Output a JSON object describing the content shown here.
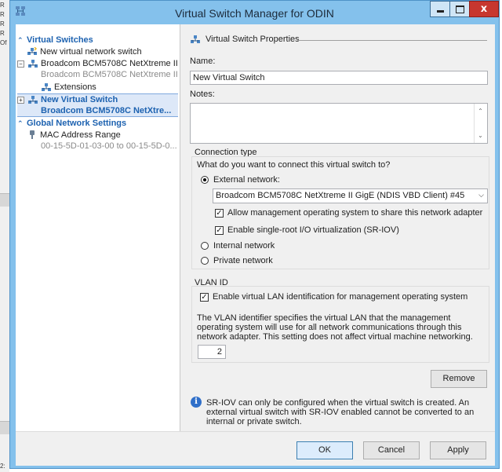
{
  "background_app": {
    "fragments": [
      "R",
      "R",
      "R",
      "R",
      "Of"
    ],
    "bottom_fragment": "2:"
  },
  "window": {
    "title": "Virtual Switch Manager for ODIN",
    "close_label": "x"
  },
  "tree": {
    "virtual_switches": {
      "label": "Virtual Switches",
      "new_switch": "New virtual network switch",
      "switch1": {
        "name": "Broadcom BCM5708C NetXtreme II ...",
        "adapter": "Broadcom BCM5708C NetXtreme II...",
        "extensions": "Extensions"
      },
      "switch2": {
        "name": "New Virtual Switch",
        "adapter": "Broadcom BCM5708C NetXtre..."
      }
    },
    "global": {
      "label": "Global Network Settings",
      "mac_range": "MAC Address Range",
      "mac_value": "00-15-5D-01-03-00 to 00-15-5D-0..."
    }
  },
  "properties": {
    "section_title": "Virtual Switch Properties",
    "name_label": "Name:",
    "name_value": "New Virtual Switch",
    "notes_label": "Notes:",
    "connection": {
      "title": "Connection type",
      "question": "What do you want to connect this virtual switch to?",
      "external": "External network:",
      "adapter_selected": "Broadcom BCM5708C NetXtreme II GigE (NDIS VBD Client) #45",
      "allow_mgmt": "Allow management operating system to share this network adapter",
      "sriov": "Enable single-root I/O virtualization (SR-IOV)",
      "internal": "Internal network",
      "private": "Private network"
    },
    "vlan": {
      "title": "VLAN ID",
      "enable": "Enable virtual LAN identification for management operating system",
      "description": "The VLAN identifier specifies the virtual LAN that the management operating system will use for all network communications through this network adapter. This setting does not affect virtual machine networking.",
      "value": "2"
    },
    "remove_label": "Remove",
    "info_text": "SR-IOV can only be configured when the virtual switch is created. An external virtual switch with SR-IOV enabled cannot be converted to an internal or private switch."
  },
  "buttons": {
    "ok": "OK",
    "cancel": "Cancel",
    "apply": "Apply"
  },
  "icons": {
    "title": "switch-manager-icon",
    "network": "network-switch-icon",
    "new_switch": "new-switch-icon",
    "mac": "mac-address-icon",
    "info": "info-icon",
    "checkmark": "✓"
  },
  "colors": {
    "window_frame": "#84c1ec",
    "close_button": "#c7372f",
    "category_text": "#1d62b0",
    "selection": "#dde8f8"
  }
}
